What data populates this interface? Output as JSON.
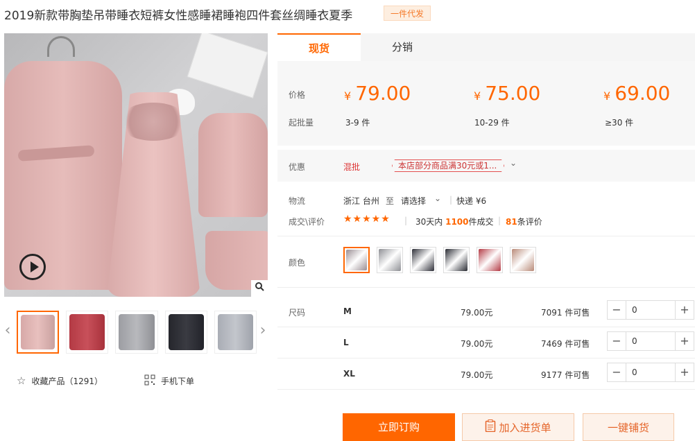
{
  "product": {
    "title": "2019新款带胸垫吊带睡衣短裤女性感睡裙睡袍四件套丝绸睡衣夏季",
    "badge": "一件代发"
  },
  "gallery": {
    "zoom_icon": "magnifier-icon",
    "play_icon": "play-icon",
    "prev_icon": "chevron-left-icon",
    "next_icon": "chevron-right-icon",
    "thumb_count": 5
  },
  "actions_left": {
    "favorite_label": "收藏产品（1291）",
    "mobile_label": "手机下单"
  },
  "tabs": [
    {
      "label": "现货",
      "active": true
    },
    {
      "label": "分销",
      "active": false
    }
  ],
  "pricing": {
    "price_label": "价格",
    "min_label": "起批量",
    "currency": "¥",
    "tiers": [
      {
        "price": "79.00",
        "range": "3-9 件"
      },
      {
        "price": "75.00",
        "range": "10-29 件"
      },
      {
        "price": "69.00",
        "range": "≥30 件"
      }
    ]
  },
  "discount": {
    "label": "优惠",
    "type": "混批",
    "chip": "本店部分商品满30元或1...",
    "caret": "⌄"
  },
  "logistics": {
    "label": "物流",
    "from": "浙江 台州",
    "to_word": "至",
    "select": "请选择",
    "shipping": "快递 ¥6"
  },
  "deals": {
    "label": "成交\\评价",
    "rating": 4.5,
    "stars": "★★★★★",
    "sales_prefix": "30天内",
    "sales_count": "1100",
    "sales_suffix": "件成交",
    "reviews_count": "81",
    "reviews_suffix": "条评价"
  },
  "colors": {
    "label": "颜色",
    "options": [
      "#9a8e93",
      "#8e8f94",
      "#2e2f38",
      "#2a2c34",
      "#b43c46",
      "#b98a78"
    ]
  },
  "sizes": {
    "label": "尺码",
    "rows": [
      {
        "name": "M",
        "price": "79.00元",
        "stock": "7091 件可售",
        "qty": "0"
      },
      {
        "name": "L",
        "price": "79.00元",
        "stock": "7469 件可售",
        "qty": "0"
      },
      {
        "name": "XL",
        "price": "79.00元",
        "stock": "9177 件可售",
        "qty": "0"
      }
    ]
  },
  "buttons": {
    "buy": "立即订购",
    "add_list": "加入进货单",
    "one_click": "一键铺货"
  },
  "theme": {
    "accent": "#ff6600"
  }
}
